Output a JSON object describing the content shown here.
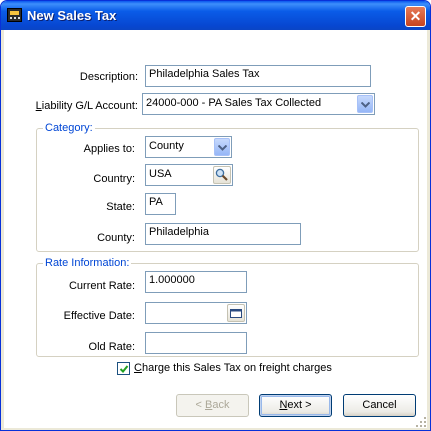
{
  "window": {
    "title": "New Sales Tax",
    "close_label": "✕"
  },
  "form": {
    "description": {
      "label": "Description:",
      "value": "Philadelphia Sales Tax"
    },
    "liability": {
      "label_pre": "L",
      "label_post": "iability G/L Account:",
      "value": "24000-000 - PA Sales Tax Collected"
    },
    "category": {
      "legend": "Category:",
      "applies_to": {
        "label": "Applies to:",
        "value": "County"
      },
      "country": {
        "label": "Country:",
        "value": "USA"
      },
      "state": {
        "label": "State:",
        "value": "PA"
      },
      "county": {
        "label": "County:",
        "value": "Philadelphia"
      }
    },
    "rate_info": {
      "legend": "Rate Information:",
      "current_rate": {
        "label": "Current Rate:",
        "value": "1.000000"
      },
      "effective_date": {
        "label": "Effective Date:",
        "value": ""
      },
      "old_rate": {
        "label": "Old Rate:",
        "value": ""
      }
    },
    "freight": {
      "pre": "C",
      "post": "harge this Sales Tax on freight charges",
      "checked": true
    }
  },
  "buttons": {
    "back": {
      "pre": "< ",
      "u": "B",
      "post": "ack",
      "enabled": false
    },
    "next": {
      "pre": "",
      "u": "N",
      "post": "ext >",
      "enabled": true
    },
    "cancel": {
      "label": "Cancel"
    }
  },
  "icons": {
    "app": "pos-terminal-icon",
    "lookup": "magnifier-icon",
    "calendar": "calendar-icon",
    "dropdown": "chevron-down-icon",
    "check": "checkmark-icon"
  },
  "colors": {
    "titlebar": "#0a5ce8",
    "close": "#c74420",
    "legend": "#0046d5",
    "border": "#7f9db9"
  }
}
